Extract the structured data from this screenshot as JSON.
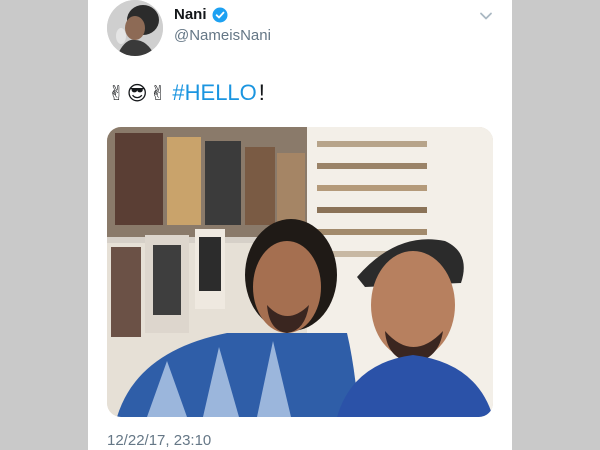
{
  "tweet": {
    "author_name": "Nani",
    "author_handle": "@NameisNani",
    "text_emojis": [
      "✌",
      "😎",
      "✌"
    ],
    "hashtag": "#HELLO",
    "exclamation": "!",
    "timestamp": "12/22/17, 23:10"
  },
  "icons": {
    "verified": "verified-badge-icon",
    "menu": "chevron-down-icon"
  },
  "colors": {
    "link": "#1b95e0",
    "verified": "#1da1f2",
    "secondary_text": "#657786"
  }
}
